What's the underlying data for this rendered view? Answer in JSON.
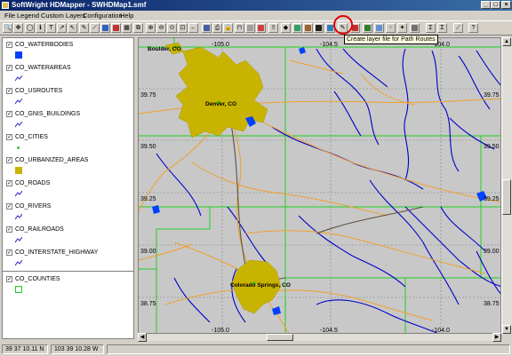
{
  "window": {
    "title": "SoftWright HDMapper - SWHDMap1.smf"
  },
  "menu": [
    "File",
    "Legend",
    "Custom Layers",
    "Configuration",
    "Help"
  ],
  "toolbar": {
    "tooltip": "Create layer file for Path Routes"
  },
  "legend": [
    {
      "label": "CO_WATERBODIES",
      "checked": true,
      "symbol": "fill-blue"
    },
    {
      "label": "CO_WATERAREAS",
      "checked": true,
      "symbol": "line-blue"
    },
    {
      "label": "CO_USROUTES",
      "checked": true,
      "symbol": "line-blue"
    },
    {
      "label": "CO_GNIS_BUILDINGS",
      "checked": true,
      "symbol": "line-blue"
    },
    {
      "label": "CO_CITIES",
      "checked": true,
      "symbol": "dot-green"
    },
    {
      "label": "CO_URBANIZED_AREAS",
      "checked": true,
      "symbol": "fill-yellow"
    },
    {
      "label": "CO_ROADS",
      "checked": true,
      "symbol": "line-blue"
    },
    {
      "label": "CO_RIVERS",
      "checked": true,
      "symbol": "line-blue"
    },
    {
      "label": "CO_RAILROADS",
      "checked": true,
      "symbol": "line-blue"
    },
    {
      "label": "CO_INTERSTATE_HIGHWAY",
      "checked": true,
      "symbol": "line-blue"
    },
    {
      "label": "CO_COUNTIES",
      "checked": true,
      "symbol": "outline-green"
    }
  ],
  "map": {
    "cities": [
      "Boulder, CO",
      "Denver, CO",
      "Colorado Springs, CO"
    ],
    "grid_labels": {
      "top": [
        "-105.0",
        "-104.5",
        "-104.0"
      ],
      "bottom": [
        "-105.0",
        "-104.5",
        "-104.0"
      ],
      "left": [
        "39.75",
        "39.50",
        "39.25",
        "39.00",
        "38.75"
      ],
      "right": [
        "39.75",
        "39.50",
        "39.25",
        "39.00",
        "38.75"
      ]
    },
    "colors": {
      "background": "#c8c8c8",
      "rivers": "#0000c8",
      "roads": "#f0a030",
      "counties": "#20d020",
      "urban": "#c8b400",
      "water": "#0040ff"
    }
  },
  "status": {
    "latitude": "39 37 10.11 N",
    "longitude": "103 39 10.28 W"
  }
}
